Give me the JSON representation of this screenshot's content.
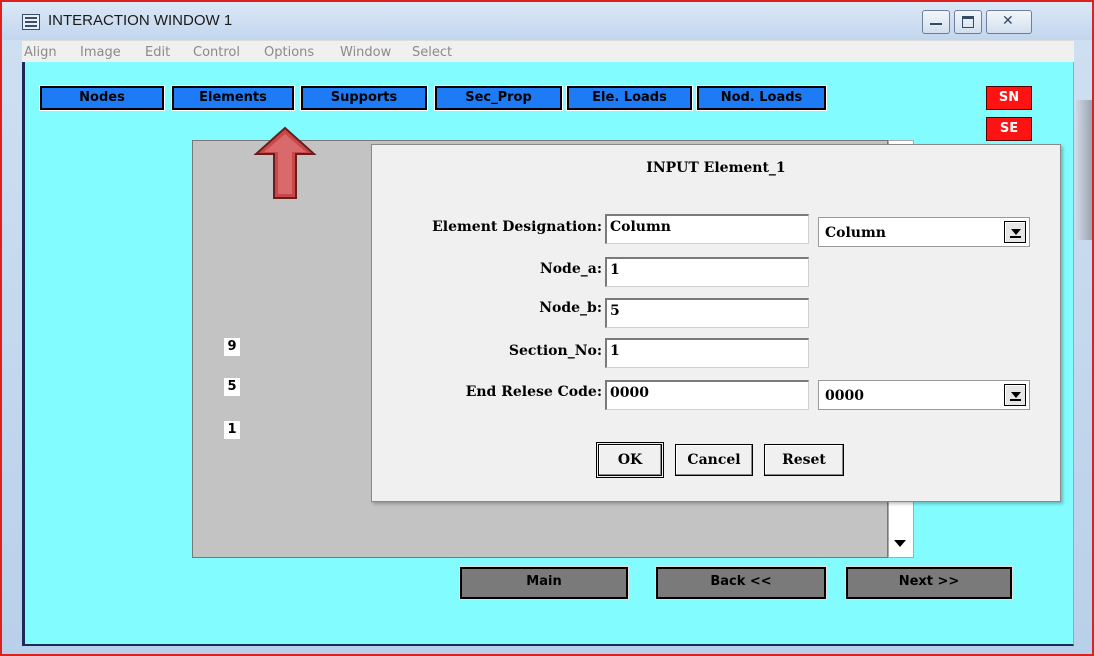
{
  "window": {
    "title": "INTERACTION WINDOW 1",
    "controls": [
      "minimize-icon",
      "maximize-icon",
      "close-icon"
    ]
  },
  "menu": [
    "Align",
    "Image",
    "Edit",
    "Control",
    "Options",
    "Window",
    "Select"
  ],
  "toolbar": {
    "tabs": [
      "Nodes",
      "Elements",
      "Supports",
      "Sec_Prop",
      "Ele. Loads",
      "Nod. Loads"
    ],
    "right_buttons": [
      "SN",
      "SE"
    ]
  },
  "canvas": {
    "node_labels": [
      "9",
      "5",
      "1"
    ]
  },
  "dialog": {
    "title": "INPUT Element_1",
    "fields": {
      "element_designation": {
        "label": "Element Designation:",
        "value": "Column",
        "select": "Column"
      },
      "node_a": {
        "label": "Node_a:",
        "value": "1"
      },
      "node_b": {
        "label": "Node_b:",
        "value": "5"
      },
      "section_no": {
        "label": "Section_No:",
        "value": "1"
      },
      "end_release_code": {
        "label": "End Relese Code:",
        "value": "0000",
        "select": "0000"
      }
    },
    "buttons": {
      "ok": "OK",
      "cancel": "Cancel",
      "reset": "Reset"
    }
  },
  "nav": {
    "main": "Main",
    "back": "Back <<",
    "next": "Next >>"
  },
  "colors": {
    "client_bg": "#82fcff",
    "tab_blue": "#1d7cf5",
    "red_button": "#ff1212",
    "nav_gray": "#7a7a7a",
    "arrow": "#c8484a"
  }
}
